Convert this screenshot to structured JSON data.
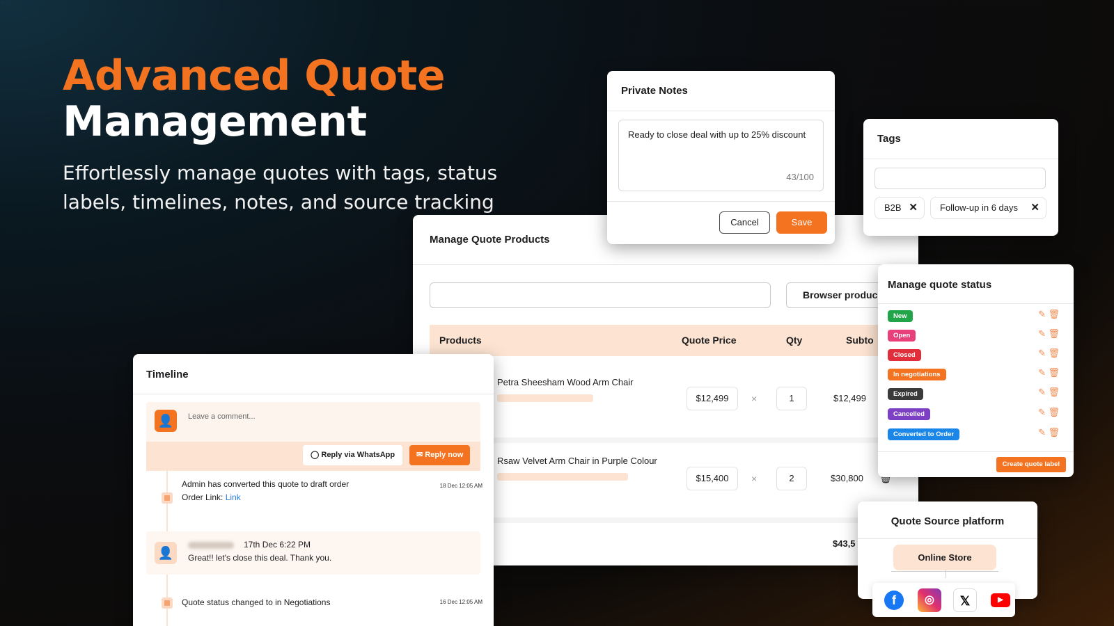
{
  "hero": {
    "title_line1": "Advanced Quote",
    "title_line2": "Management",
    "subtitle": "Effortlessly manage quotes with tags, status labels, timelines, notes, and source tracking"
  },
  "products": {
    "title": "Manage Quote Products",
    "browse_label": "Browser produc",
    "columns": [
      "Products",
      "Quote Price",
      "Qty",
      "Subto"
    ],
    "rows": [
      {
        "name": "Petra Sheesham Wood Arm Chair",
        "price": "$12,499",
        "qty": "1",
        "subtotal": "$12,499"
      },
      {
        "name": "Rsaw Velvet Arm Chair in Purple Colour",
        "price": "$15,400",
        "qty": "2",
        "subtotal": "$30,800"
      }
    ],
    "total": "$43,5",
    "multiply_symbol": "×"
  },
  "notes": {
    "title": "Private Notes",
    "text": "Ready to close deal with up to 25% discount",
    "count": "43/100",
    "cancel": "Cancel",
    "save": "Save"
  },
  "tags": {
    "title": "Tags",
    "items": [
      "B2B",
      "Follow-up in 6 days"
    ]
  },
  "status": {
    "title": "Manage quote status",
    "items": [
      {
        "label": "New",
        "color": "#22a548"
      },
      {
        "label": "Open",
        "color": "#e8407a"
      },
      {
        "label": "Closed",
        "color": "#e02f3b"
      },
      {
        "label": "In negotiations",
        "color": "#f47321"
      },
      {
        "label": "Expired",
        "color": "#3a3a3a"
      },
      {
        "label": "Cancelled",
        "color": "#7d3fc4"
      },
      {
        "label": "Converted to Order",
        "color": "#1a86e8"
      }
    ],
    "create_label": "Create quote label"
  },
  "source": {
    "title": "Quote Source platform",
    "store": "Online Store",
    "platforms": [
      "facebook-icon",
      "instagram-icon",
      "x-icon",
      "youtube-icon"
    ]
  },
  "timeline": {
    "title": "Timeline",
    "placeholder": "Leave a comment...",
    "whatsapp_label": "Reply via WhatsApp",
    "reply_label": "Reply now",
    "events": [
      {
        "text": "Admin has converted this quote to draft order",
        "link_prefix": "Order Link: ",
        "link": "Link",
        "time": "18 Dec 12:05 AM"
      },
      {
        "date": "17th Dec 6:22 PM",
        "message": "Great!! let's close this deal. Thank you."
      },
      {
        "text": "Quote status changed to in Negotiations",
        "time": "16 Dec 12:05 AM"
      }
    ]
  },
  "colors": {
    "accent": "#f47321",
    "accent_light": "#fde4d2"
  }
}
